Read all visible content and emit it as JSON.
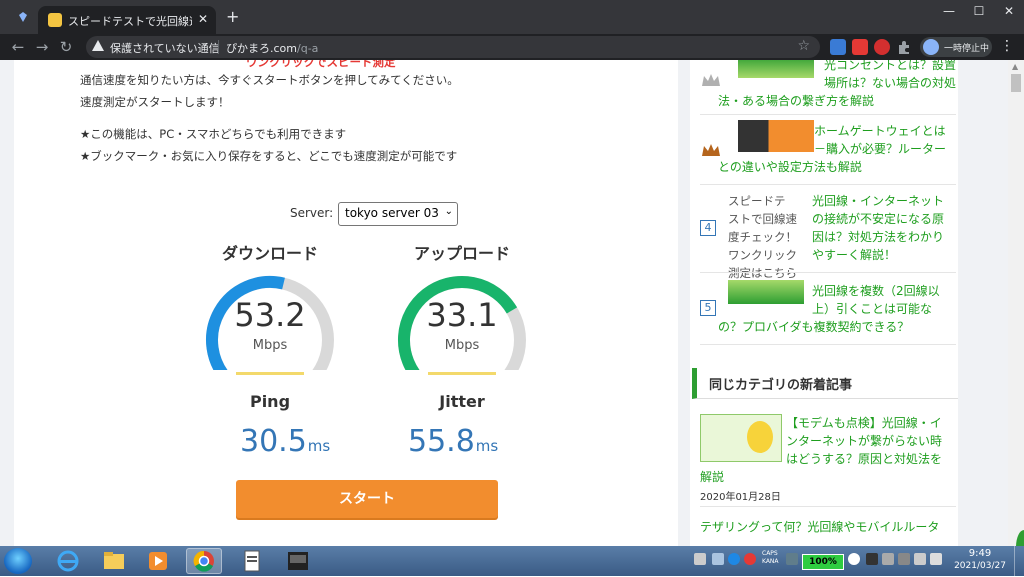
{
  "browser": {
    "tab_title": "スピードテストで光回線速度測定",
    "tab_close": "✕",
    "new_tab": "+",
    "security_label": "保護されていない通信",
    "url_domain": "ぴかまろ.com",
    "url_path": "/q-a",
    "profile_label": "一時停止中",
    "menu": "⋮",
    "win_minimize": "—",
    "win_maximize": "☐",
    "win_close": "✕",
    "nav_back": "←",
    "nav_forward": "→",
    "nav_reload": "↻",
    "bookmark": "☆"
  },
  "intro": {
    "line_red": "ワンクリックでスピード測定",
    "line2": "通信速度を知りたい方は、今すぐスタートボタンを押してみてください。",
    "line3": "速度測定がスタートします！",
    "line4": "★この機能は、PC・スマホどちらでも利用できます",
    "line5": "★ブックマーク・お気に入り保存をすると、どこでも速度測定が可能です"
  },
  "server": {
    "label": "Server:",
    "selected": "tokyo server 03",
    "caret": "⌄"
  },
  "download": {
    "title": "ダウンロード",
    "value": "53.2",
    "unit": "Mbps",
    "fraction": 0.55,
    "color": "#1e90e0"
  },
  "upload": {
    "title": "アップロード",
    "value": "33.1",
    "unit": "Mbps",
    "fraction": 0.72,
    "color": "#18b46b"
  },
  "ping": {
    "label": "Ping",
    "value": "30.5",
    "unit": "ms"
  },
  "jitter": {
    "label": "Jitter",
    "value": "55.8",
    "unit": "ms"
  },
  "start_button": "スタート",
  "sidebar": {
    "rank2_lines": [
      "光コンセントとは？設置",
      "場所は？ない場合の対処",
      "法・ある場合の繋ぎ方を解説"
    ],
    "rank3_lines": [
      "ホームゲートウェイとは",
      "－購入が必要？ルーター",
      "との違いや設定方法も解説"
    ],
    "rank4_alt_lines": [
      "スピードテ",
      "ストで回線速",
      "度チェック！",
      "ワンクリック",
      "測定はこちら"
    ],
    "rank4_lines": [
      "光回線・インターネット",
      "の接続が不安定になる原",
      "因は？対処方法をわかり",
      "やすーく解説！"
    ],
    "rank5_lines": [
      "光回線を複数（2回線以",
      "上）引くことは可能な",
      "の？プロバイダも複数契約できる？"
    ],
    "rank4_num": "4",
    "rank5_num": "5",
    "category_heading": "同じカテゴリの新着記事",
    "article1_lines": [
      "【モデムも点検】光回線・イ",
      "ンターネットが繋がらない時",
      "はどうする？原因と対処法を",
      "解説"
    ],
    "article1_date": "2020年01月28日",
    "article2_line": "テザリングって何？光回線やモバイルルータ"
  },
  "taskbar": {
    "caps": "CAPS",
    "kana": "KANA",
    "battery": "100%",
    "time": "9:49",
    "date": "2021/03/27"
  }
}
